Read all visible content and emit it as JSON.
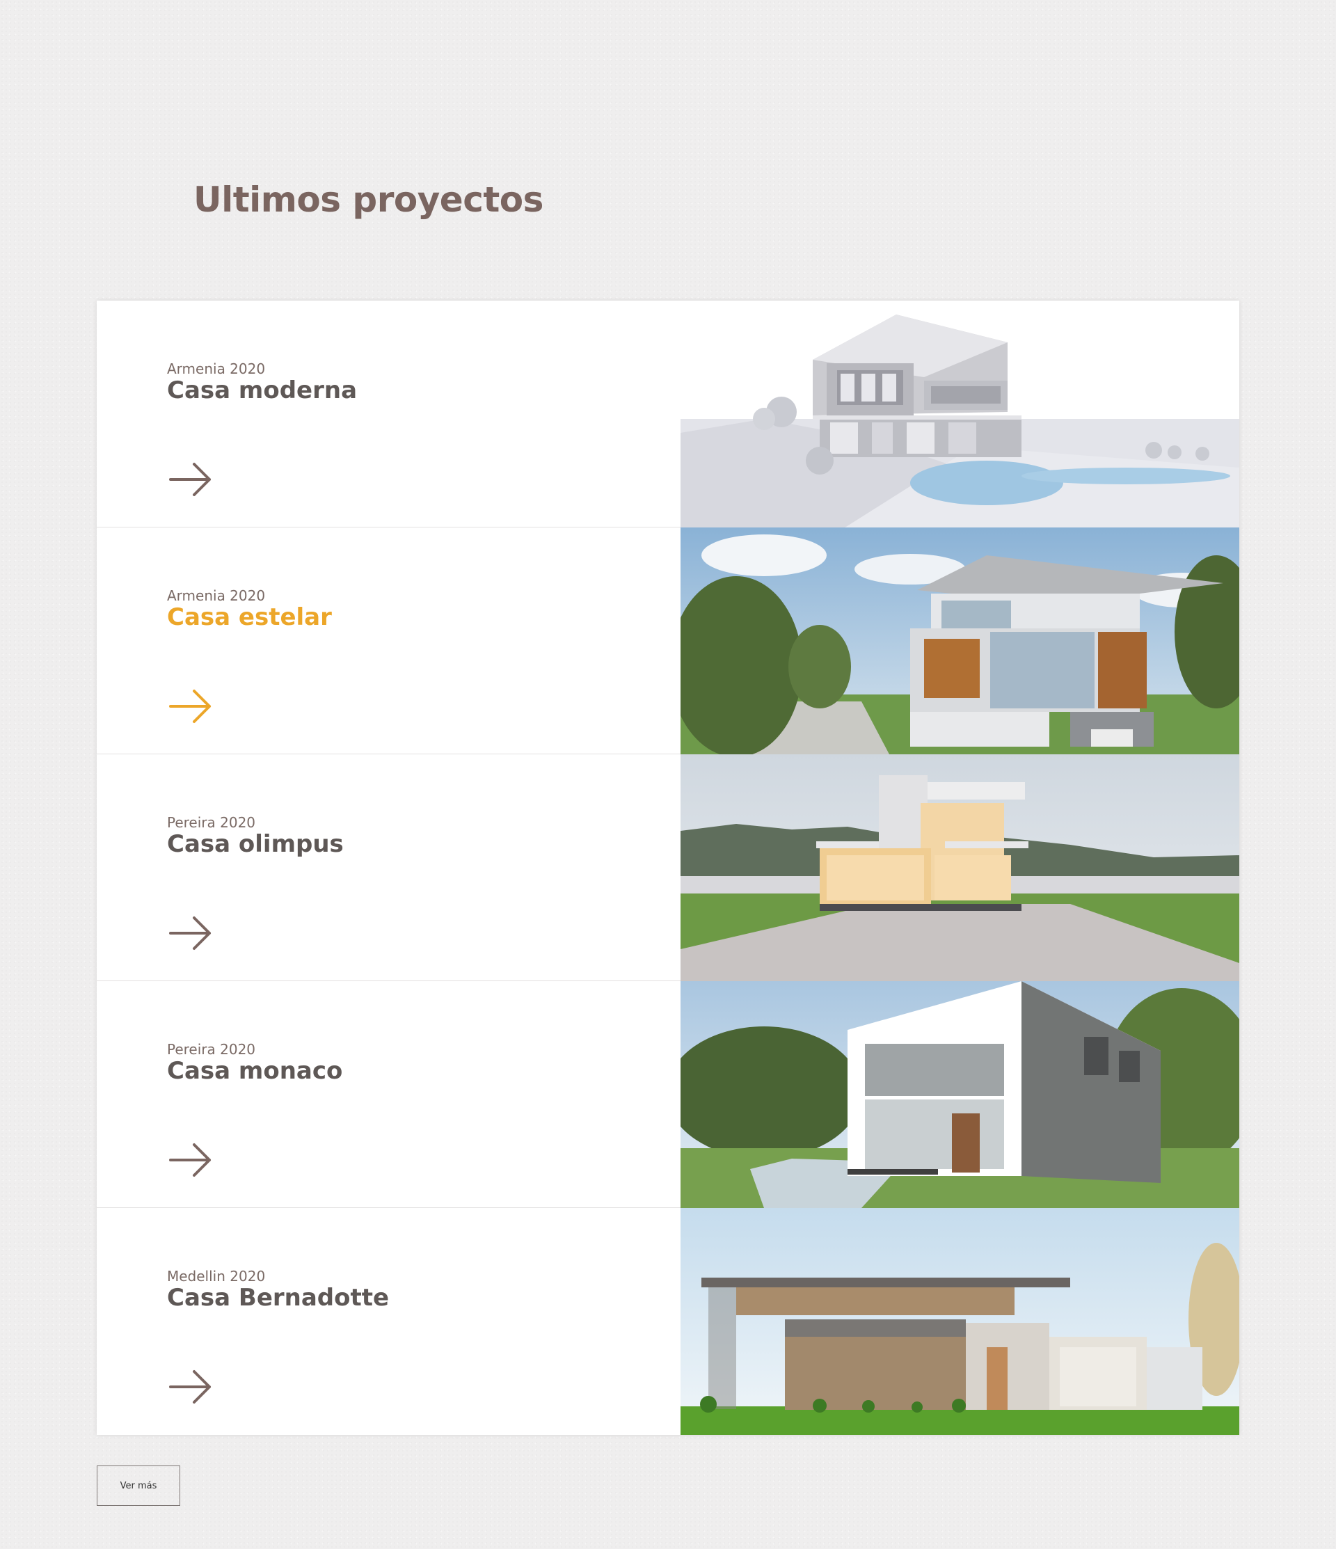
{
  "section": {
    "title": "Ultimos proyectos"
  },
  "accent_color": "#eca629",
  "text_color": "#5e5856",
  "projects": [
    {
      "location": "Armenia 2020",
      "name": "Casa moderna",
      "active": false,
      "image": "white-render-house-with-pool"
    },
    {
      "location": "Armenia 2020",
      "name": "Casa estelar",
      "active": true,
      "image": "wood-glass-house-with-trees"
    },
    {
      "location": "Pereira 2020",
      "name": "Casa olimpus",
      "active": false,
      "image": "lit-house-with-mountains"
    },
    {
      "location": "Pereira 2020",
      "name": "Casa monaco",
      "active": false,
      "image": "grey-white-cube-house-with-terrace"
    },
    {
      "location": "Medellin 2020",
      "name": "Casa Bernadotte",
      "active": false,
      "image": "wood-facade-house-with-lawn"
    }
  ],
  "more_button": {
    "label": "Ver más"
  }
}
